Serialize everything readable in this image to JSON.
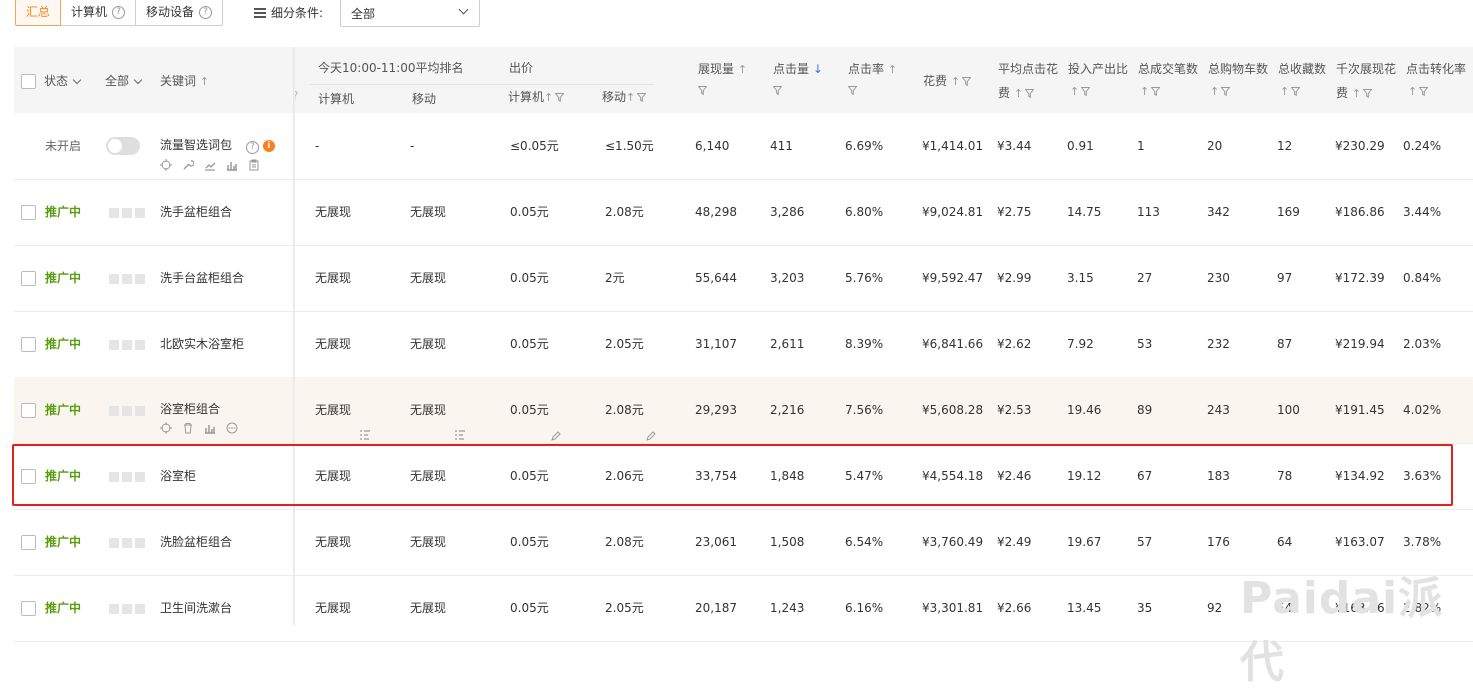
{
  "toolbar": {
    "tabs": [
      "汇总",
      "计算机",
      "移动设备"
    ],
    "filter_label": "细分条件:",
    "filter_value": "全部"
  },
  "header": {
    "status": "状态",
    "all": "全部",
    "keyword": "关键词",
    "rank_group": "今天10:00-11:00平均排名",
    "rank_pc": "计算机",
    "rank_mobile": "移动",
    "bid_group": "出价",
    "bid_pc": "计算机",
    "bid_mobile": "移动",
    "impressions": "展现量",
    "clicks": "点击量",
    "ctr": "点击率",
    "cost": "花费",
    "avg_cpc_1": "平均点击花",
    "avg_cpc_2": "费",
    "roi": "投入产出比",
    "orders": "总成交笔数",
    "carts": "总购物车数",
    "favorites": "总收藏数",
    "cpm_1": "千次展现花",
    "cpm_2": "费",
    "cvr": "点击转化率"
  },
  "rows": [
    {
      "status": "未开启",
      "keyword": "流量智选词包",
      "rank_pc": "-",
      "rank_mobile": "-",
      "bid_pc": "≤0.05元",
      "bid_mobile": "≤1.50元",
      "impressions": "6,140",
      "clicks": "411",
      "ctr": "6.69%",
      "cost": "¥1,414.01",
      "cpc": "¥3.44",
      "roi": "0.91",
      "orders": "1",
      "carts": "20",
      "favorites": "12",
      "cpm": "¥230.29",
      "cvr": "0.24%"
    },
    {
      "status": "推广中",
      "keyword": "洗手盆柜组合",
      "rank_pc": "无展现",
      "rank_mobile": "无展现",
      "bid_pc": "0.05元",
      "bid_mobile": "2.08元",
      "impressions": "48,298",
      "clicks": "3,286",
      "ctr": "6.80%",
      "cost": "¥9,024.81",
      "cpc": "¥2.75",
      "roi": "14.75",
      "orders": "113",
      "carts": "342",
      "favorites": "169",
      "cpm": "¥186.86",
      "cvr": "3.44%"
    },
    {
      "status": "推广中",
      "keyword": "洗手台盆柜组合",
      "rank_pc": "无展现",
      "rank_mobile": "无展现",
      "bid_pc": "0.05元",
      "bid_mobile": "2元",
      "impressions": "55,644",
      "clicks": "3,203",
      "ctr": "5.76%",
      "cost": "¥9,592.47",
      "cpc": "¥2.99",
      "roi": "3.15",
      "orders": "27",
      "carts": "230",
      "favorites": "97",
      "cpm": "¥172.39",
      "cvr": "0.84%"
    },
    {
      "status": "推广中",
      "keyword": "北欧实木浴室柜",
      "rank_pc": "无展现",
      "rank_mobile": "无展现",
      "bid_pc": "0.05元",
      "bid_mobile": "2.05元",
      "impressions": "31,107",
      "clicks": "2,611",
      "ctr": "8.39%",
      "cost": "¥6,841.66",
      "cpc": "¥2.62",
      "roi": "7.92",
      "orders": "53",
      "carts": "232",
      "favorites": "87",
      "cpm": "¥219.94",
      "cvr": "2.03%"
    },
    {
      "status": "推广中",
      "keyword": "浴室柜组合",
      "rank_pc": "无展现",
      "rank_mobile": "无展现",
      "bid_pc": "0.05元",
      "bid_mobile": "2.08元",
      "impressions": "29,293",
      "clicks": "2,216",
      "ctr": "7.56%",
      "cost": "¥5,608.28",
      "cpc": "¥2.53",
      "roi": "19.46",
      "orders": "89",
      "carts": "243",
      "favorites": "100",
      "cpm": "¥191.45",
      "cvr": "4.02%"
    },
    {
      "status": "推广中",
      "keyword": "浴室柜",
      "rank_pc": "无展现",
      "rank_mobile": "无展现",
      "bid_pc": "0.05元",
      "bid_mobile": "2.06元",
      "impressions": "33,754",
      "clicks": "1,848",
      "ctr": "5.47%",
      "cost": "¥4,554.18",
      "cpc": "¥2.46",
      "roi": "19.12",
      "orders": "67",
      "carts": "183",
      "favorites": "78",
      "cpm": "¥134.92",
      "cvr": "3.63%"
    },
    {
      "status": "推广中",
      "keyword": "洗脸盆柜组合",
      "rank_pc": "无展现",
      "rank_mobile": "无展现",
      "bid_pc": "0.05元",
      "bid_mobile": "2.08元",
      "impressions": "23,061",
      "clicks": "1,508",
      "ctr": "6.54%",
      "cost": "¥3,760.49",
      "cpc": "¥2.49",
      "roi": "19.67",
      "orders": "57",
      "carts": "176",
      "favorites": "64",
      "cpm": "¥163.07",
      "cvr": "3.78%"
    },
    {
      "status": "推广中",
      "keyword": "卫生间洗漱台",
      "rank_pc": "无展现",
      "rank_mobile": "无展现",
      "bid_pc": "0.05元",
      "bid_mobile": "2.05元",
      "impressions": "20,187",
      "clicks": "1,243",
      "ctr": "6.16%",
      "cost": "¥3,301.81",
      "cpc": "¥2.66",
      "roi": "13.45",
      "orders": "35",
      "carts": "92",
      "favorites": "54",
      "cpm": "¥163.56",
      "cvr": "2.82%"
    }
  ],
  "watermark": "Paidai派代",
  "colors": {
    "accent": "#ff7e1c",
    "active_status": "#5a9e0f",
    "highlight_border": "#e8201c",
    "sort_active": "#3a7ae8"
  }
}
